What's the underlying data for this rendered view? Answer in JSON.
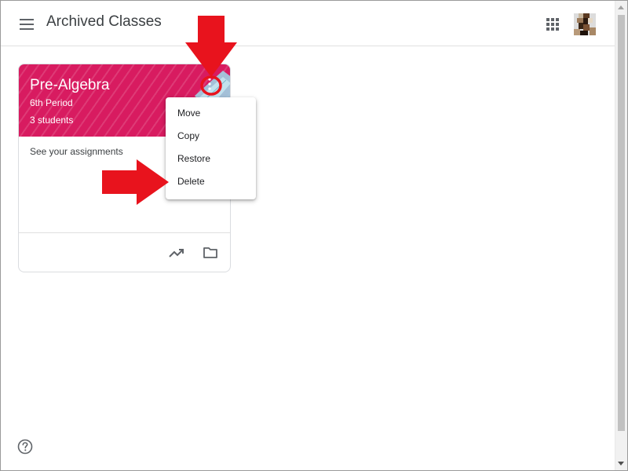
{
  "header": {
    "title": "Archived Classes",
    "menu_icon": "hamburger-menu-icon",
    "apps_icon": "apps-grid-icon",
    "avatar": "user-avatar"
  },
  "card": {
    "title": "Pre-Algebra",
    "section": "6th Period",
    "students": "3 students",
    "body_text": "See your assignments",
    "theme_color": "#d81b60",
    "more_icon": "more-vert-icon",
    "footer_icons": [
      "trending-up-icon",
      "folder-icon"
    ]
  },
  "context_menu": {
    "items": [
      {
        "label": "Move"
      },
      {
        "label": "Copy"
      },
      {
        "label": "Restore"
      },
      {
        "label": "Delete"
      }
    ]
  },
  "help_icon": "help-icon",
  "annotation_color": "#e8131d"
}
